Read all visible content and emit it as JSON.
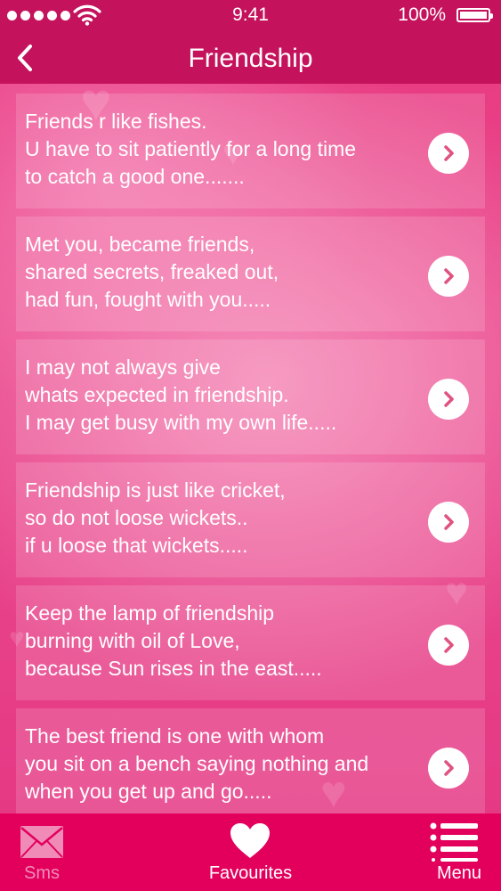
{
  "status_bar": {
    "time": "9:41",
    "battery": "100%",
    "icons": [
      "signal-dots-icon",
      "wifi-icon",
      "battery-icon"
    ]
  },
  "nav": {
    "title": "Friendship",
    "back_icon": "chevron-left-icon"
  },
  "messages": [
    {
      "lines": [
        "Friends r like fishes.",
        "U have to sit patiently for a long time",
        "to catch a good one......."
      ]
    },
    {
      "lines": [
        "Met you, became friends,",
        "shared secrets, freaked out,",
        "had fun, fought with you....."
      ]
    },
    {
      "lines": [
        "I may not always give",
        "whats expected in friendship.",
        "I may get busy with my own life....."
      ]
    },
    {
      "lines": [
        "Friendship is just like cricket,",
        "so do not loose wickets..",
        "if u loose that wickets....."
      ]
    },
    {
      "lines": [
        "Keep the lamp of friendship",
        "burning with oil of Love,",
        "because Sun rises in the east....."
      ]
    },
    {
      "lines": [
        "The best friend is one with whom",
        "you sit on a bench saying nothing and",
        "when you get up and go....."
      ]
    }
  ],
  "tabs": {
    "sms": {
      "label": "Sms",
      "icon": "envelope-icon"
    },
    "favourites": {
      "label": "Favourites",
      "icon": "heart-icon"
    },
    "menu": {
      "label": "Menu",
      "icon": "list-menu-icon"
    }
  },
  "colors": {
    "header": "#c4125c",
    "tab_bar": "#e3005d",
    "background": "#e9458b",
    "chevron": "#e0527f",
    "inactive_tab": "#f08bb8"
  }
}
